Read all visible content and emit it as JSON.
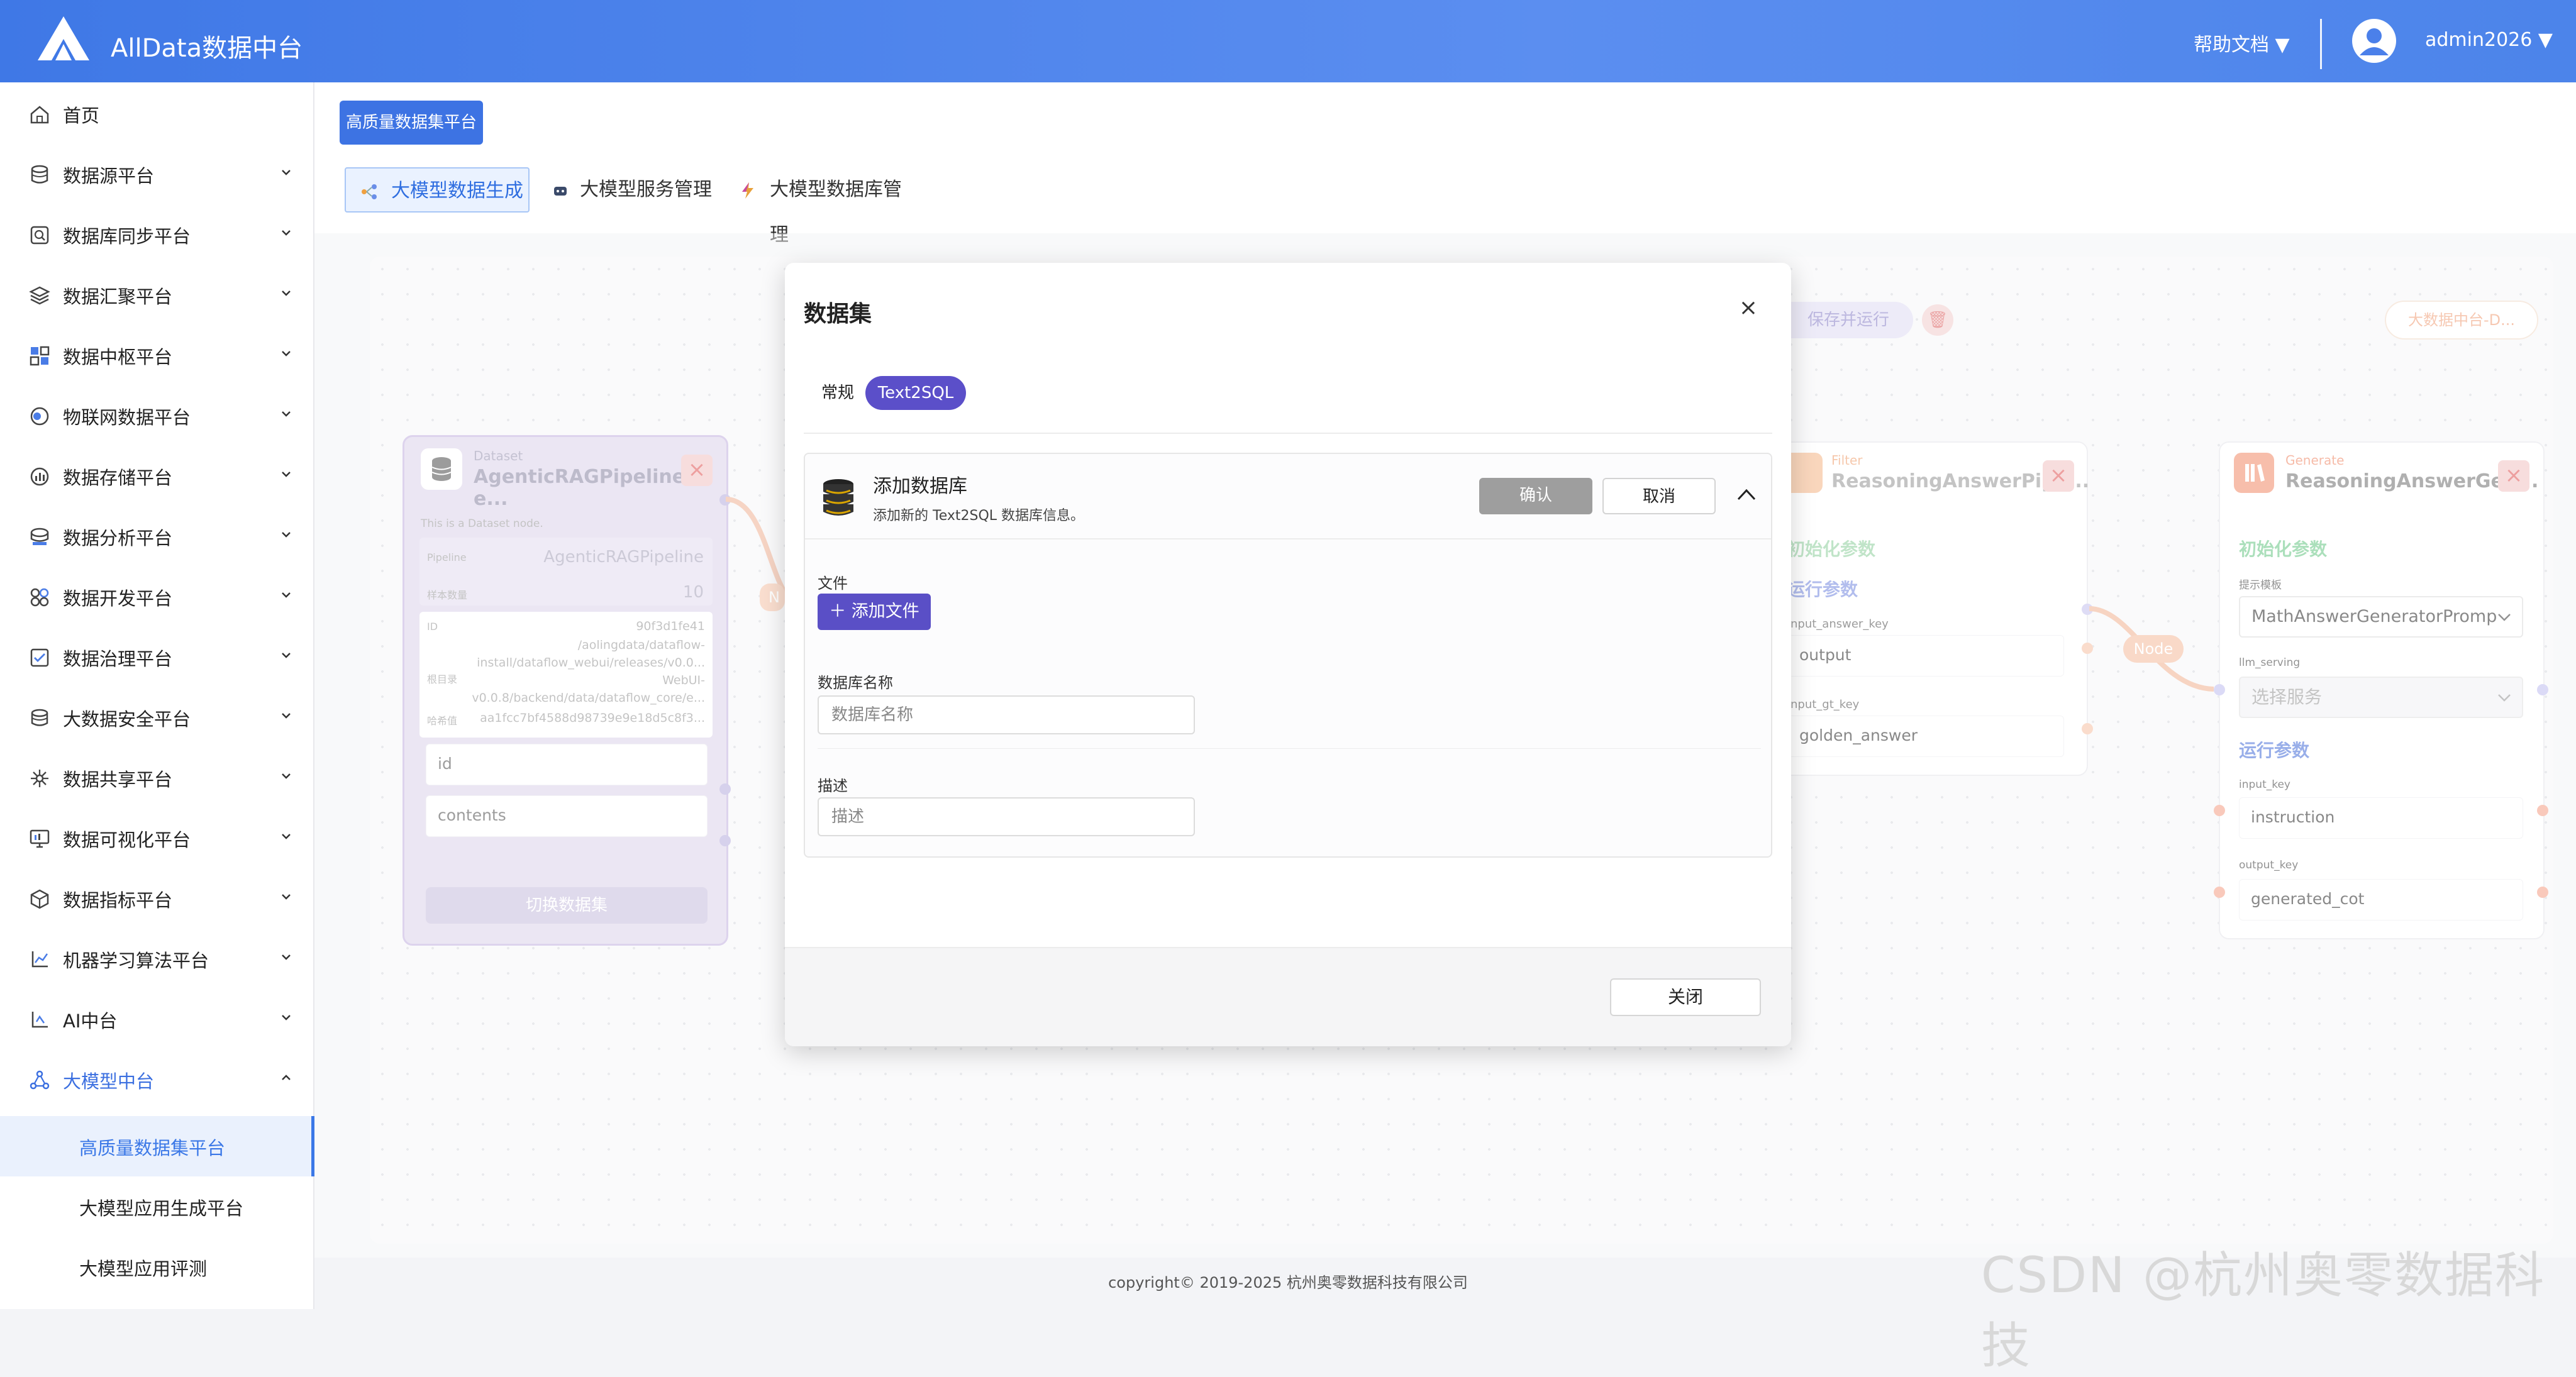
{
  "header": {
    "app_title": "AllData数据中台",
    "help_label": "帮助文档 ▼",
    "username": "admin2026 ▼"
  },
  "sidebar": {
    "items": [
      {
        "label": "首页"
      },
      {
        "label": "数据源平台"
      },
      {
        "label": "数据库同步平台"
      },
      {
        "label": "数据汇聚平台"
      },
      {
        "label": "数据中枢平台"
      },
      {
        "label": "物联网数据平台"
      },
      {
        "label": "数据存储平台"
      },
      {
        "label": "数据分析平台"
      },
      {
        "label": "数据开发平台"
      },
      {
        "label": "数据治理平台"
      },
      {
        "label": "大数据安全平台"
      },
      {
        "label": "数据共享平台"
      },
      {
        "label": "数据可视化平台"
      },
      {
        "label": "数据指标平台"
      },
      {
        "label": "机器学习算法平台"
      },
      {
        "label": "AI中台"
      },
      {
        "label": "大模型中台"
      }
    ],
    "sub_items": [
      {
        "label": "高质量数据集平台"
      },
      {
        "label": "大模型应用生成平台"
      },
      {
        "label": "大模型应用评测"
      }
    ]
  },
  "page": {
    "breadcrumb_button": "高质量数据集平台",
    "tabs": [
      {
        "label": "大模型数据生成"
      },
      {
        "label": "大模型服务管理"
      },
      {
        "label": "大模型数据库管理"
      }
    ]
  },
  "canvas": {
    "save_run": "保存并运行",
    "bigdata_btn": "大数据中台-D...",
    "node_link1": "N",
    "node_link2": "Node",
    "dataset_node": {
      "type": "Dataset",
      "title": "AgenticRAGPipeline-e...",
      "desc": "This is a Dataset node.",
      "pipeline_label": "Pipeline",
      "pipeline_value": "AgenticRAGPipeline",
      "sample_label": "样本数量",
      "sample_value": "10",
      "id_label": "ID",
      "id_value": "90f3d1fe41",
      "root_label": "根目录",
      "root_lines": [
        "/aolingdata/dataflow-",
        "install/dataflow_webui/releases/v0.0...",
        "WebUI-",
        "v0.0.8/backend/data/dataflow_core/e..."
      ],
      "hash_label": "哈希值",
      "hash_value": "aa1fcc7bf4588d98739e9e18d5c8f3...",
      "fields": [
        "id",
        "contents"
      ],
      "switch_btn": "切换数据集"
    },
    "filter_node": {
      "type": "Filter",
      "title": "ReasoningAnswerPipe...",
      "init_params": "初始化参数",
      "run_params": "运行参数",
      "k1_label": "input_answer_key",
      "k1_value": "output",
      "k2_label": "input_gt_key",
      "k2_value": "golden_answer"
    },
    "generate_node": {
      "type": "Generate",
      "title": "ReasoningAnswerGen...",
      "init_params": "初始化参数",
      "prompt_label": "提示模板",
      "prompt_value": "MathAnswerGeneratorPromp",
      "serving_label": "llm_serving",
      "serving_value": "选择服务",
      "run_params": "运行参数",
      "in_label": "input_key",
      "in_value": "instruction",
      "out_label": "output_key",
      "out_value": "generated_cot"
    }
  },
  "modal": {
    "title": "数据集",
    "close_x": "×",
    "tabs": [
      "常规",
      "Text2SQL"
    ],
    "panel": {
      "title": "添加数据库",
      "subtitle": "添加新的 Text2SQL 数据库信息。",
      "confirm": "确认",
      "cancel": "取消",
      "file_label": "文件",
      "add_file": "＋ 添加文件",
      "dbname_label": "数据库名称",
      "dbname_placeholder": "数据库名称",
      "desc_label": "描述",
      "desc_placeholder": "描述"
    },
    "footer_close": "关闭"
  },
  "footer": {
    "copyright": "copyright© 2019-2025 杭州奥零数据科技有限公司"
  },
  "watermark": "CSDN @杭州奥零数据科技"
}
